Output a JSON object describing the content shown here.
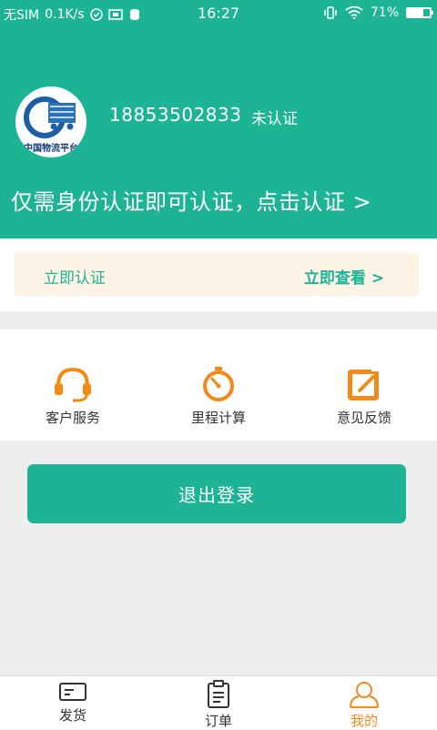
{
  "status_bar": {
    "carrier": "无SIM",
    "speed": "0.1K/s",
    "time": "16:27",
    "battery": "71%",
    "battery_level": 0.71
  },
  "profile": {
    "avatar_text": "中国物流平台",
    "phone": "18853502833",
    "verify_status": "未认证",
    "hint": "仅需身份认证即可认证，点击认证 >"
  },
  "notice": {
    "left_label": "立即认证",
    "right_label": "立即查看 >"
  },
  "tools": [
    {
      "label": "客户服务",
      "icon": "headset-icon"
    },
    {
      "label": "里程计算",
      "icon": "timer-icon"
    },
    {
      "label": "意见反馈",
      "icon": "feedback-icon"
    }
  ],
  "logout": {
    "label": "退出登录"
  },
  "bottom_nav": [
    {
      "label": "发货",
      "icon": "card-icon",
      "active": false
    },
    {
      "label": "订单",
      "icon": "clipboard-icon",
      "active": false
    },
    {
      "label": "我的",
      "icon": "person-icon",
      "active": true
    }
  ],
  "colors": {
    "primary": "#1cb495",
    "accent": "#f28a1a",
    "notice_bg": "#fdf4e6"
  }
}
